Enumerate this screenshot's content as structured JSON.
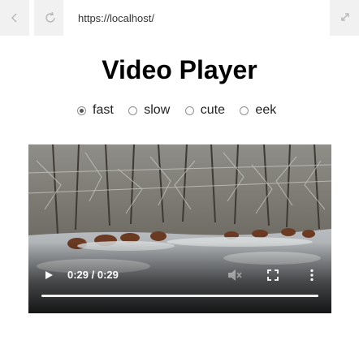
{
  "browser": {
    "url": "https://localhost/",
    "icons": {
      "back": "chevron-left-icon",
      "reload": "reload-icon",
      "expand": "expand-diagonal-icon"
    }
  },
  "page": {
    "title": "Video Player"
  },
  "speed_options": [
    {
      "label": "fast",
      "checked": true
    },
    {
      "label": "slow",
      "checked": false
    },
    {
      "label": "cute",
      "checked": false
    },
    {
      "label": "eek",
      "checked": false
    }
  ],
  "video": {
    "time_display": "0:29 / 0:29",
    "progress": 1.0,
    "muted_icon_disabled": true,
    "icons": {
      "play": "play-icon",
      "mute": "volume-muted-icon",
      "fullscreen": "fullscreen-icon",
      "more": "more-vertical-icon"
    }
  }
}
